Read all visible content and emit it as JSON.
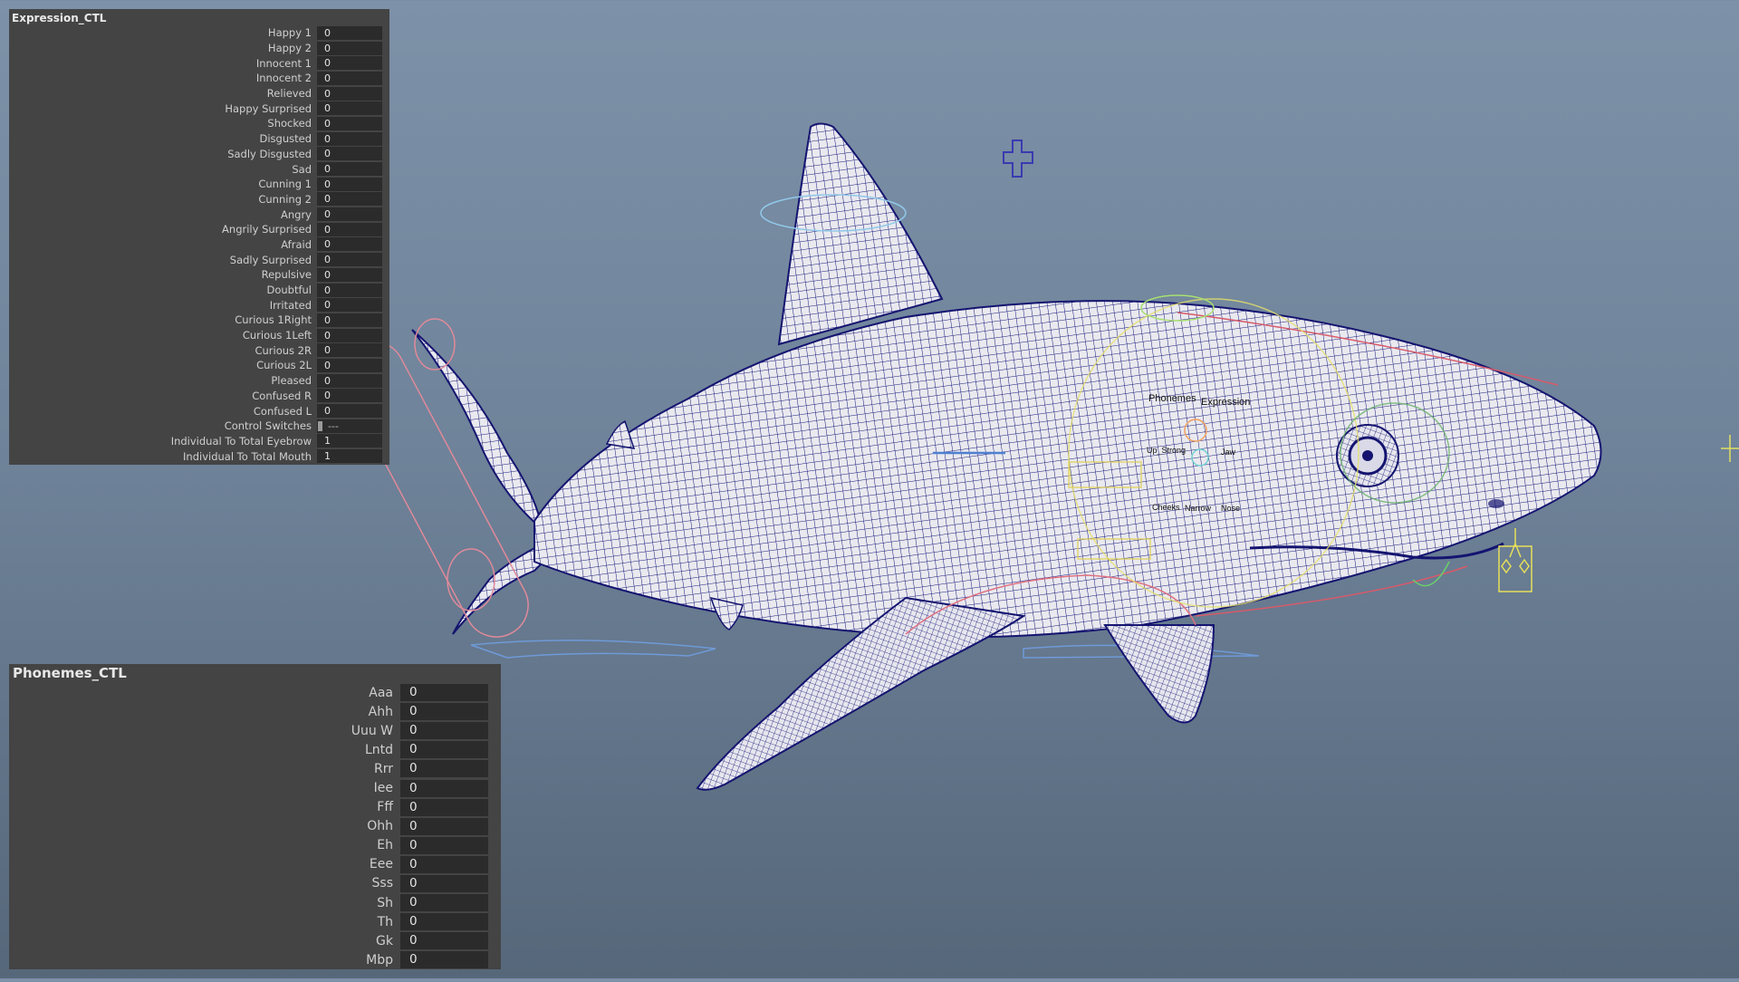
{
  "expression_panel": {
    "title": "Expression_CTL",
    "attributes": [
      {
        "label": "Happy 1",
        "value": "0"
      },
      {
        "label": "Happy 2",
        "value": "0"
      },
      {
        "label": "Innocent 1",
        "value": "0"
      },
      {
        "label": "Innocent 2",
        "value": "0"
      },
      {
        "label": "Relieved",
        "value": "0"
      },
      {
        "label": "Happy Surprised",
        "value": "0"
      },
      {
        "label": "Shocked",
        "value": "0"
      },
      {
        "label": "Disgusted",
        "value": "0"
      },
      {
        "label": "Sadly Disgusted",
        "value": "0"
      },
      {
        "label": "Sad",
        "value": "0"
      },
      {
        "label": "Cunning 1",
        "value": "0"
      },
      {
        "label": "Cunning 2",
        "value": "0"
      },
      {
        "label": "Angry",
        "value": "0"
      },
      {
        "label": "Angrily Surprised",
        "value": "0"
      },
      {
        "label": "Afraid",
        "value": "0"
      },
      {
        "label": "Sadly Surprised",
        "value": "0"
      },
      {
        "label": "Repulsive",
        "value": "0"
      },
      {
        "label": "Doubtful",
        "value": "0"
      },
      {
        "label": "Irritated",
        "value": "0"
      },
      {
        "label": "Curious 1Right",
        "value": "0"
      },
      {
        "label": "Curious 1Left",
        "value": "0"
      },
      {
        "label": "Curious 2R",
        "value": "0"
      },
      {
        "label": "Curious 2L",
        "value": "0"
      },
      {
        "label": "Pleased",
        "value": "0"
      },
      {
        "label": "Confused R",
        "value": "0"
      },
      {
        "label": "Confused L",
        "value": "0"
      },
      {
        "label": "Control Switches",
        "value": "---"
      },
      {
        "label": "Individual To Total Eyebrow",
        "value": "1"
      },
      {
        "label": "Individual To Total Mouth",
        "value": "1"
      }
    ]
  },
  "phonemes_panel": {
    "title": "Phonemes_CTL",
    "attributes": [
      {
        "label": "Aaa",
        "value": "0"
      },
      {
        "label": "Ahh",
        "value": "0"
      },
      {
        "label": "Uuu W",
        "value": "0"
      },
      {
        "label": "Lntd",
        "value": "0"
      },
      {
        "label": "Rrr",
        "value": "0"
      },
      {
        "label": "Iee",
        "value": "0"
      },
      {
        "label": "Fff",
        "value": "0"
      },
      {
        "label": "Ohh",
        "value": "0"
      },
      {
        "label": "Eh",
        "value": "0"
      },
      {
        "label": "Eee",
        "value": "0"
      },
      {
        "label": "Sss",
        "value": "0"
      },
      {
        "label": "Sh",
        "value": "0"
      },
      {
        "label": "Th",
        "value": "0"
      },
      {
        "label": "Gk",
        "value": "0"
      },
      {
        "label": "Mbp",
        "value": "0"
      }
    ]
  },
  "viewport": {
    "model": "shark-mesh",
    "controls": {
      "phonemes_label": "Phonemes",
      "expression_label": "Expression",
      "tag_a": "Up_Strong",
      "tag_b": "Jaw",
      "tag_c": "Cheeks",
      "tag_d": "Narrow",
      "tag_e": "Nose"
    },
    "colors": {
      "background_top": "#7d91a8",
      "background_bottom": "#56677a",
      "wire": "#141470",
      "mesh": "#e9e9ef",
      "panel": "#444444",
      "field": "#2b2b2b"
    }
  }
}
